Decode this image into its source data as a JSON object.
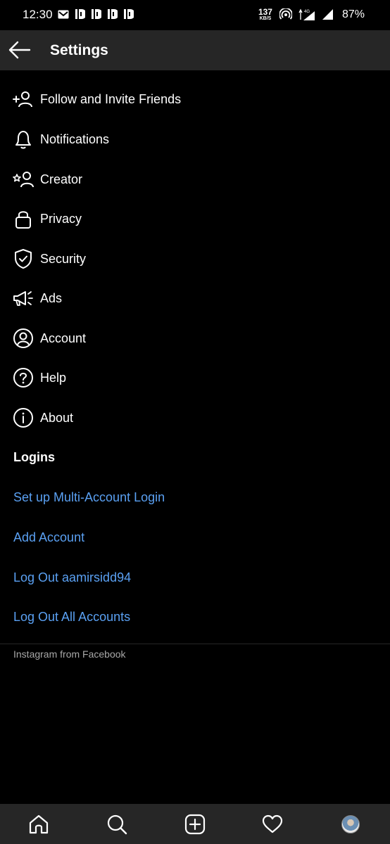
{
  "status_bar": {
    "time": "12:30",
    "net_speed": "137",
    "net_unit": "KB/S",
    "network_type": "4G",
    "battery": "87%"
  },
  "header": {
    "title": "Settings",
    "back_icon": "arrow-left-icon"
  },
  "menu": [
    {
      "label": "Follow and Invite Friends",
      "icon": "add-person-icon"
    },
    {
      "label": "Notifications",
      "icon": "bell-icon"
    },
    {
      "label": "Creator",
      "icon": "star-person-icon"
    },
    {
      "label": "Privacy",
      "icon": "lock-icon"
    },
    {
      "label": "Security",
      "icon": "shield-check-icon"
    },
    {
      "label": "Ads",
      "icon": "megaphone-icon"
    },
    {
      "label": "Account",
      "icon": "user-circle-icon"
    },
    {
      "label": "Help",
      "icon": "help-circle-icon"
    },
    {
      "label": "About",
      "icon": "info-circle-icon"
    }
  ],
  "logins": {
    "title": "Logins",
    "items": [
      "Set up Multi-Account Login",
      "Add Account",
      "Log Out aamirsidd94",
      "Log Out All Accounts"
    ]
  },
  "footer": {
    "text": "Instagram from Facebook"
  },
  "bottom_nav": [
    "home-icon",
    "search-icon",
    "new-post-icon",
    "heart-icon",
    "profile-avatar"
  ],
  "colors": {
    "background": "#000000",
    "bar": "#262626",
    "link": "#5aa0f2",
    "text": "#ffffff",
    "muted": "#a8a8a8"
  }
}
